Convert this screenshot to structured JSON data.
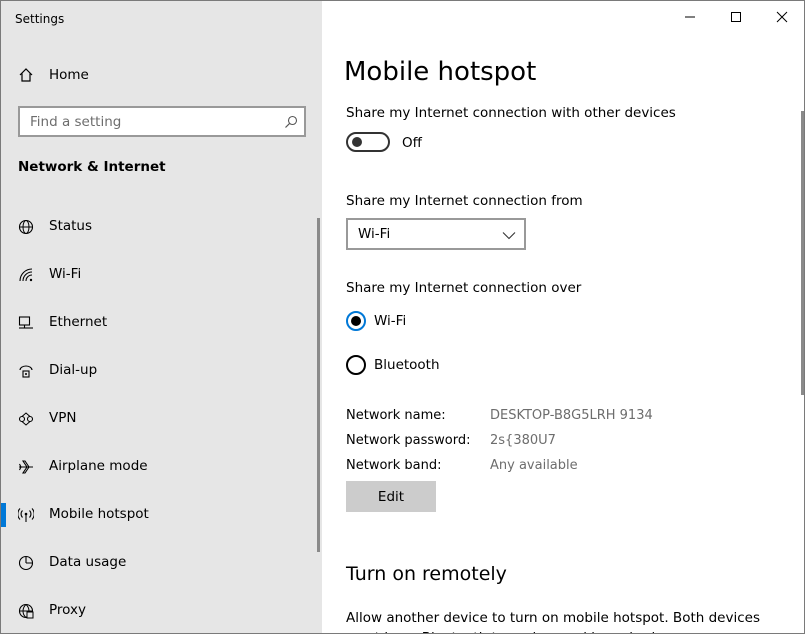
{
  "app": {
    "title": "Settings"
  },
  "sidebar": {
    "home_label": "Home",
    "search_placeholder": "Find a setting",
    "section_title": "Network & Internet",
    "items": [
      {
        "label": "Status",
        "icon": "globe-icon"
      },
      {
        "label": "Wi-Fi",
        "icon": "wifi-icon"
      },
      {
        "label": "Ethernet",
        "icon": "ethernet-icon"
      },
      {
        "label": "Dial-up",
        "icon": "dialup-icon"
      },
      {
        "label": "VPN",
        "icon": "vpn-icon"
      },
      {
        "label": "Airplane mode",
        "icon": "airplane-icon"
      },
      {
        "label": "Mobile hotspot",
        "icon": "hotspot-icon",
        "active": true
      },
      {
        "label": "Data usage",
        "icon": "data-usage-icon"
      },
      {
        "label": "Proxy",
        "icon": "proxy-icon"
      }
    ]
  },
  "main": {
    "title": "Mobile hotspot",
    "share_label": "Share my Internet connection with other devices",
    "toggle_state": "Off",
    "share_from_label": "Share my Internet connection from",
    "share_from_value": "Wi-Fi",
    "share_over_label": "Share my Internet connection over",
    "share_over_options": [
      {
        "label": "Wi-Fi",
        "checked": true
      },
      {
        "label": "Bluetooth",
        "checked": false
      }
    ],
    "network_name_label": "Network name:",
    "network_name_value": "DESKTOP-B8G5LRH 9134",
    "network_password_label": "Network password:",
    "network_password_value": "2s{380U7",
    "network_band_label": "Network band:",
    "network_band_value": "Any available",
    "edit_label": "Edit",
    "remote_title": "Turn on remotely",
    "remote_desc": "Allow another device to turn on mobile hotspot. Both devices must have Bluetooth turned on and be paired."
  },
  "colors": {
    "accent": "#0078d7",
    "sidebar_bg": "#e6e6e6"
  }
}
